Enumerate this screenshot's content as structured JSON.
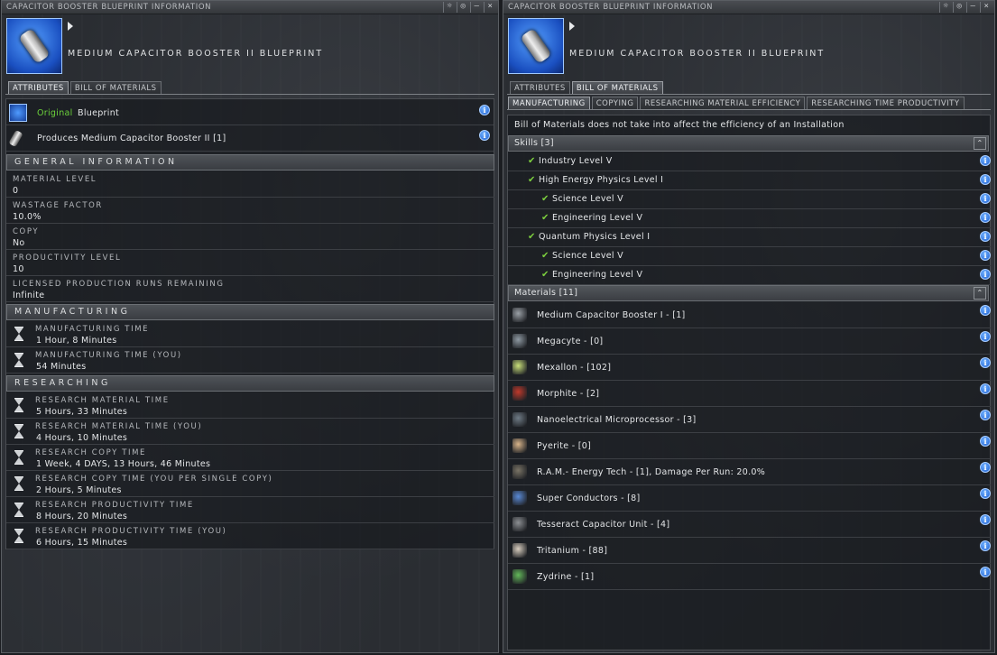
{
  "left": {
    "title": "CAPACITOR BOOSTER BLUEPRINT INFORMATION",
    "item_name": "MEDIUM CAPACITOR BOOSTER II BLUEPRINT",
    "tabs": [
      "ATTRIBUTES",
      "BILL OF MATERIALS"
    ],
    "active_tab": "ATTRIBUTES",
    "original_word": "Original",
    "original_rest": "Blueprint",
    "produces": "Produces Medium Capacitor Booster II [1]",
    "sections": {
      "general": "GENERAL INFORMATION",
      "manufacturing": "MANUFACTURING",
      "researching": "RESEARCHING"
    },
    "general": [
      {
        "label": "MATERIAL LEVEL",
        "value": "0"
      },
      {
        "label": "WASTAGE FACTOR",
        "value": "10.0%"
      },
      {
        "label": "COPY",
        "value": "No"
      },
      {
        "label": "PRODUCTIVITY LEVEL",
        "value": "10"
      },
      {
        "label": "LICENSED PRODUCTION RUNS REMAINING",
        "value": "Infinite"
      }
    ],
    "manufacturing": [
      {
        "label": "MANUFACTURING TIME",
        "value": "1 Hour, 8 Minutes"
      },
      {
        "label": "MANUFACTURING TIME (YOU)",
        "value": "54 Minutes"
      }
    ],
    "researching": [
      {
        "label": "RESEARCH MATERIAL TIME",
        "value": "5 Hours, 33 Minutes"
      },
      {
        "label": "RESEARCH MATERIAL TIME (YOU)",
        "value": "4 Hours, 10 Minutes"
      },
      {
        "label": "RESEARCH COPY TIME",
        "value": "1 Week, 4 DAYS, 13 Hours, 46 Minutes"
      },
      {
        "label": "RESEARCH COPY TIME (YOU PER SINGLE COPY)",
        "value": "2 Hours, 5 Minutes"
      },
      {
        "label": "RESEARCH PRODUCTIVITY TIME",
        "value": "8 Hours, 20 Minutes"
      },
      {
        "label": "RESEARCH PRODUCTIVITY TIME (YOU)",
        "value": "6 Hours, 15 Minutes"
      }
    ]
  },
  "right": {
    "title": "CAPACITOR BOOSTER BLUEPRINT INFORMATION",
    "item_name": "MEDIUM CAPACITOR BOOSTER II BLUEPRINT",
    "tabs": [
      "ATTRIBUTES",
      "BILL OF MATERIALS"
    ],
    "active_tab": "BILL OF MATERIALS",
    "subtabs": [
      "MANUFACTURING",
      "COPYING",
      "RESEARCHING MATERIAL EFFICIENCY",
      "RESEARCHING TIME PRODUCTIVITY"
    ],
    "active_subtab": "MANUFACTURING",
    "note": "Bill of Materials does not take into affect the efficiency of an Installation",
    "skills_header": "Skills [3]",
    "skills": [
      {
        "name": "Industry Level V",
        "indent": 1
      },
      {
        "name": "High Energy Physics Level I",
        "indent": 1
      },
      {
        "name": "Science Level V",
        "indent": 2
      },
      {
        "name": "Engineering Level V",
        "indent": 2
      },
      {
        "name": "Quantum Physics Level I",
        "indent": 1
      },
      {
        "name": "Science Level V",
        "indent": 2
      },
      {
        "name": "Engineering Level V",
        "indent": 2
      }
    ],
    "materials_header": "Materials [11]",
    "materials": [
      {
        "name": "Medium Capacitor Booster I - [1]",
        "icon": "capacitor-booster-icon",
        "color": "#9aa0a6"
      },
      {
        "name": "Megacyte - [0]",
        "icon": "megacyte-icon",
        "color": "#8f9aa3"
      },
      {
        "name": "Mexallon - [102]",
        "icon": "mexallon-icon",
        "color": "#c9e07a"
      },
      {
        "name": "Morphite - [2]",
        "icon": "morphite-icon",
        "color": "#c0392b"
      },
      {
        "name": "Nanoelectrical Microprocessor - [3]",
        "icon": "microprocessor-icon",
        "color": "#6f7b86"
      },
      {
        "name": "Pyerite - [0]",
        "icon": "pyerite-icon",
        "color": "#d8b48a"
      },
      {
        "name": "R.A.M.- Energy Tech - [1], Damage Per Run: 20.0%",
        "icon": "ram-energy-tech-icon",
        "color": "#7a7466"
      },
      {
        "name": "Super Conductors - [8]",
        "icon": "super-conductors-icon",
        "color": "#5a8ad6"
      },
      {
        "name": "Tesseract Capacitor Unit - [4]",
        "icon": "tesseract-capacitor-icon",
        "color": "#8c8f93"
      },
      {
        "name": "Tritanium - [88]",
        "icon": "tritanium-icon",
        "color": "#d9cfc0"
      },
      {
        "name": "Zydrine - [1]",
        "icon": "zydrine-icon",
        "color": "#63b85a"
      }
    ]
  },
  "window_buttons": [
    "☼",
    "◎",
    "–",
    "×"
  ],
  "collapse_glyph": "⌃",
  "info_glyph": "i",
  "check_glyph": "✔"
}
